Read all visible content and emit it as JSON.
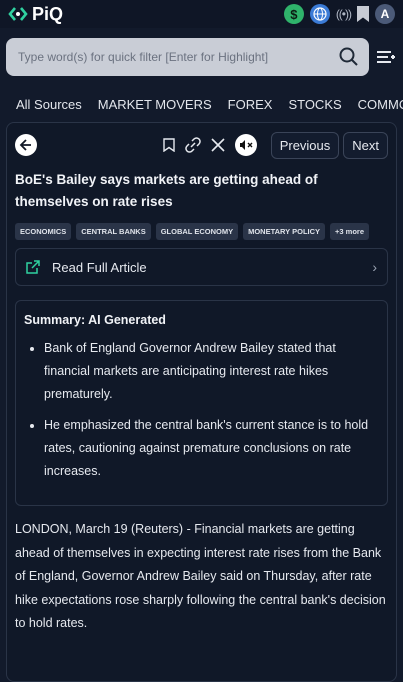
{
  "app": {
    "logo_text": "PiQ",
    "avatar_letter": "A",
    "dollar_symbol": "$"
  },
  "search": {
    "placeholder": "Type word(s) for quick filter [Enter for Highlight]"
  },
  "tabs": [
    "All Sources",
    "MARKET MOVERS",
    "FOREX",
    "STOCKS",
    "COMMO"
  ],
  "toolbar": {
    "previous_label": "Previous",
    "next_label": "Next"
  },
  "article": {
    "title": "BoE's Bailey says markets are getting ahead of themselves on rate rises",
    "tags": [
      "ECONOMICS",
      "CENTRAL BANKS",
      "GLOBAL ECONOMY",
      "MONETARY POLICY",
      "+3 more"
    ],
    "read_full": "Read Full Article",
    "summary_title": "Summary: AI Generated",
    "summary_points": [
      "Bank of England Governor Andrew Bailey stated that financial markets are anticipating interest rate hikes prematurely.",
      "He emphasized the central bank's current stance is to hold rates, cautioning against premature conclusions on rate increases."
    ],
    "body": "LONDON, March 19 (Reuters) - Financial markets are getting ahead of themselves in expecting interest rate rises from the Bank of England, Governor Andrew Bailey said on Thursday, after rate hike expectations rose sharply following the central bank's decision to hold rates."
  }
}
